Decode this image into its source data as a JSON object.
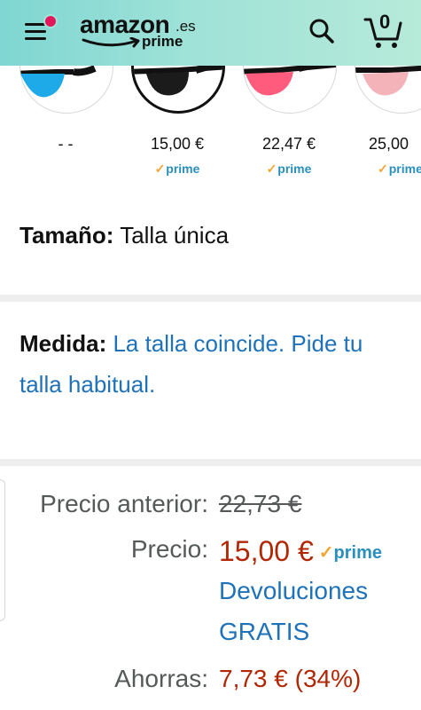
{
  "header": {
    "logo_word": "amazon",
    "logo_tld": ".es",
    "logo_prime": "prime",
    "cart_count": "0"
  },
  "swatches": [
    {
      "price": "",
      "prime": ""
    },
    {
      "price": "- -",
      "prime": ""
    },
    {
      "price": "15,00 €",
      "prime": "prime"
    },
    {
      "price": "22,47 €",
      "prime": "prime"
    },
    {
      "price": "25,00",
      "prime": "prime"
    }
  ],
  "size": {
    "label": "Tamaño:",
    "value": "Talla única"
  },
  "medida": {
    "label": "Medida:",
    "value": "La talla coincide. Pide tu talla habitual."
  },
  "pricing": {
    "previous_label": "Precio anterior:",
    "previous_value": "22,73 €",
    "price_label": "Precio:",
    "price_value": "15,00 €",
    "prime": "prime",
    "returns_line1": "Devoluciones",
    "returns_line2": "GRATIS",
    "savings_label": "Ahorras:",
    "savings_value": "7,73 € (34%)"
  },
  "colors": {
    "accent_red": "#b12704",
    "link_blue": "#1f72b8",
    "prime_blue": "#2a8fbd",
    "check_orange": "#f0a530"
  }
}
